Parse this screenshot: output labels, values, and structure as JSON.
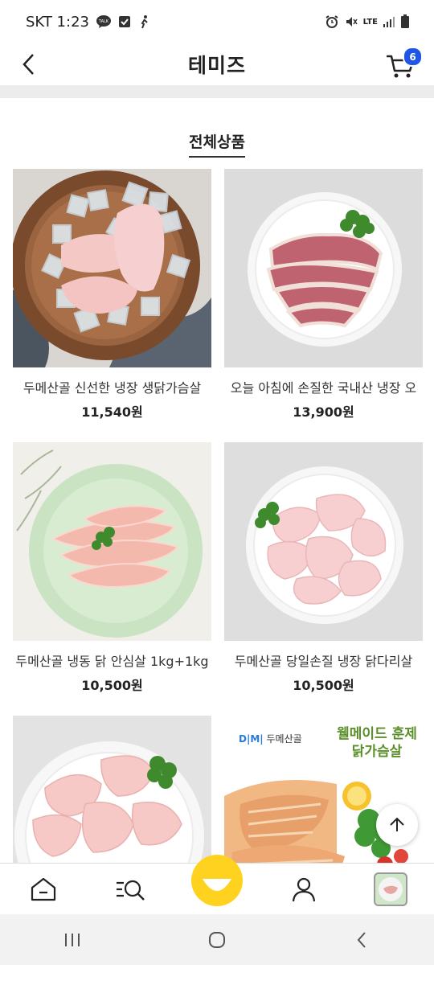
{
  "status_bar": {
    "carrier_time": "SKT 1:23",
    "network": "LTE"
  },
  "header": {
    "title": "테미즈",
    "cart_count": "6"
  },
  "section": {
    "title": "전체상품"
  },
  "products": [
    {
      "name": "두메산골 신선한 냉장 생닭가슴살",
      "price": "11,540원"
    },
    {
      "name": "오늘 아침에 손질한 국내산 냉장 오",
      "price": "13,900원"
    },
    {
      "name": "두메산골 냉동 닭 안심살 1kg+1kg",
      "price": "10,500원"
    },
    {
      "name": "두메산골 당일손질 냉장 닭다리살",
      "price": "10,500원"
    },
    {
      "name": "",
      "price": ""
    },
    {
      "name": "",
      "price": ""
    }
  ],
  "promo_banner": {
    "brand": "두메산골",
    "headline": "웰메이드 훈제 닭가슴살"
  },
  "colors": {
    "accent_yellow": "#ffd21f",
    "badge_blue": "#1f56e6"
  },
  "icons": [
    "talk-icon",
    "check-icon",
    "walk-icon",
    "alarm-icon",
    "mute-icon",
    "signal-icon",
    "battery-icon",
    "back-icon",
    "cart-icon",
    "arrow-up-icon",
    "home-icon",
    "menu-search-icon",
    "smile-icon",
    "user-icon",
    "recent-icon"
  ]
}
